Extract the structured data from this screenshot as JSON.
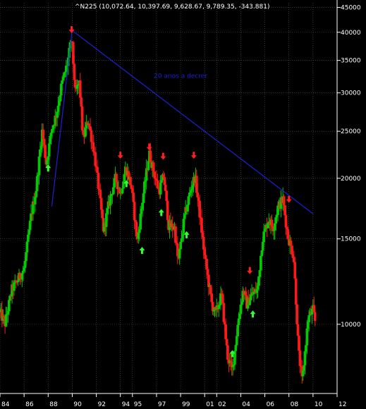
{
  "chart_data": {
    "type": "candlestick",
    "title": "^N225 (10,072.64, 10,397.69, 9,628.67, 9,789.35, -343.881)",
    "ylabel": "",
    "xlabel": "",
    "log_scale": true,
    "ylim": [
      7200,
      46000
    ],
    "xlim": [
      1984.0,
      2012.0
    ],
    "y_ticks": [
      10000,
      15000,
      20000,
      25000,
      30000,
      35000,
      40000,
      45000
    ],
    "y_tick_labels": [
      "10000",
      "15000",
      "20000",
      "25000",
      "30000",
      "35000",
      "40000",
      "45000"
    ],
    "x_ticks": [
      1984,
      1986,
      1988,
      1990,
      1992,
      1994,
      1995,
      1997,
      1999,
      2001,
      2002,
      2004,
      2006,
      2008,
      2010,
      2012
    ],
    "x_tick_labels": [
      "84",
      "86",
      "88",
      "90",
      "92",
      "94",
      "95",
      "97",
      "99",
      "01",
      "02",
      "04",
      "06",
      "08",
      "10",
      "12"
    ],
    "grid": true,
    "colors": {
      "up": "#00cc00",
      "down": "#ff1a1a",
      "trendline": "#1f1fd8",
      "up_arrow": "#33ff33",
      "down_arrow": "#ff2020",
      "grid": "#5a5a5a",
      "axis_text": "#ffffff",
      "background": "#000000"
    },
    "price_path": [
      [
        1984.0,
        10600
      ],
      [
        1984.4,
        10000
      ],
      [
        1985.0,
        11800
      ],
      [
        1985.6,
        12500
      ],
      [
        1986.0,
        13000
      ],
      [
        1986.6,
        16800
      ],
      [
        1987.0,
        19000
      ],
      [
        1987.5,
        25000
      ],
      [
        1987.85,
        21400
      ],
      [
        1988.3,
        25300
      ],
      [
        1988.7,
        27200
      ],
      [
        1989.1,
        31000
      ],
      [
        1989.6,
        34500
      ],
      [
        1989.95,
        38900
      ],
      [
        1990.25,
        30000
      ],
      [
        1990.6,
        31500
      ],
      [
        1990.9,
        24000
      ],
      [
        1991.3,
        26500
      ],
      [
        1991.8,
        22800
      ],
      [
        1992.2,
        19000
      ],
      [
        1992.6,
        15600
      ],
      [
        1993.1,
        18000
      ],
      [
        1993.6,
        20000
      ],
      [
        1994.0,
        18600
      ],
      [
        1994.45,
        21000
      ],
      [
        1994.9,
        19300
      ],
      [
        1995.4,
        14800
      ],
      [
        1995.9,
        18500
      ],
      [
        1996.4,
        22500
      ],
      [
        1996.9,
        20000
      ],
      [
        1997.2,
        18800
      ],
      [
        1997.6,
        20300
      ],
      [
        1998.0,
        16000
      ],
      [
        1998.5,
        15800
      ],
      [
        1998.8,
        13400
      ],
      [
        1999.3,
        16500
      ],
      [
        1999.8,
        18800
      ],
      [
        2000.2,
        20200
      ],
      [
        2000.6,
        16800
      ],
      [
        2001.0,
        13800
      ],
      [
        2001.6,
        11000
      ],
      [
        2001.9,
        10500
      ],
      [
        2002.4,
        11500
      ],
      [
        2002.9,
        8600
      ],
      [
        2003.3,
        8000
      ],
      [
        2003.8,
        10200
      ],
      [
        2004.2,
        11800
      ],
      [
        2004.5,
        11000
      ],
      [
        2004.9,
        11500
      ],
      [
        2005.4,
        11800
      ],
      [
        2005.8,
        15000
      ],
      [
        2006.3,
        16500
      ],
      [
        2006.7,
        15800
      ],
      [
        2007.1,
        17500
      ],
      [
        2007.5,
        18100
      ],
      [
        2007.9,
        15200
      ],
      [
        2008.4,
        13800
      ],
      [
        2008.8,
        8800
      ],
      [
        2009.1,
        7600
      ],
      [
        2009.6,
        10300
      ],
      [
        2010.0,
        10700
      ],
      [
        2010.2,
        10050
      ]
    ],
    "trendlines": [
      {
        "from": [
          1988.3,
          17500
        ],
        "to": [
          1990.0,
          40500
        ]
      },
      {
        "from": [
          1989.9,
          40500
        ],
        "to": [
          2010.0,
          16900
        ]
      }
    ],
    "annotations": [
      {
        "text": "20 anos a decrer",
        "x": 1999.0,
        "y": 32200
      }
    ],
    "up_arrows": [
      [
        1988.0,
        21000
      ],
      [
        1994.5,
        19500
      ],
      [
        1995.8,
        14200
      ],
      [
        1997.4,
        17000
      ],
      [
        1999.5,
        15300
      ],
      [
        2003.3,
        8700
      ],
      [
        2005.0,
        10500
      ]
    ],
    "down_arrows": [
      [
        1989.95,
        40500
      ],
      [
        1994.0,
        22300
      ],
      [
        1996.4,
        23200
      ],
      [
        1997.55,
        22200
      ],
      [
        2000.1,
        22300
      ],
      [
        2004.75,
        12900
      ],
      [
        2008.0,
        18100
      ]
    ]
  }
}
